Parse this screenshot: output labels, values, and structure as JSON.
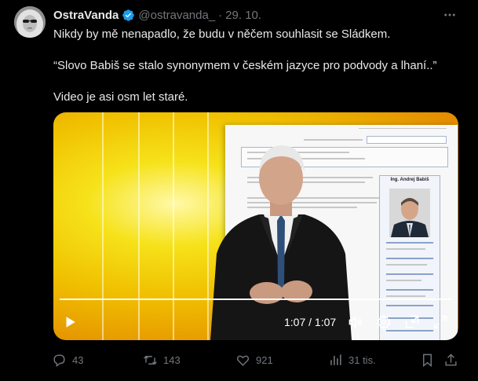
{
  "author": {
    "display_name": "OstraVanda",
    "handle": "@ostravanda_",
    "separator": "·",
    "date": "29. 10."
  },
  "tweet": {
    "paragraphs": [
      "Nikdy by mě nenapadlo, že budu v něčem souhlasit se Sládkem.",
      "“Slovo Babiš se stalo synonymem v českém jazyce pro podvody a lhaní..”",
      "Video je asi osm let staré."
    ]
  },
  "video": {
    "time_display": "1:07 / 1:07",
    "progress": 1.0,
    "infobox_title": "Ing. Andrej Babiš"
  },
  "actions": {
    "replies": "43",
    "reposts": "143",
    "likes": "921",
    "views": "31 tis."
  },
  "colors": {
    "background": "#000000",
    "text": "#e7e9ea",
    "muted": "#71767b",
    "verified": "#1d9bf0"
  },
  "icons": [
    "verified-badge-icon",
    "more-icon",
    "play-icon",
    "volume-icon",
    "settings-icon",
    "pip-icon",
    "fullscreen-icon",
    "reply-icon",
    "repost-icon",
    "like-icon",
    "views-icon",
    "bookmark-icon",
    "share-icon"
  ]
}
